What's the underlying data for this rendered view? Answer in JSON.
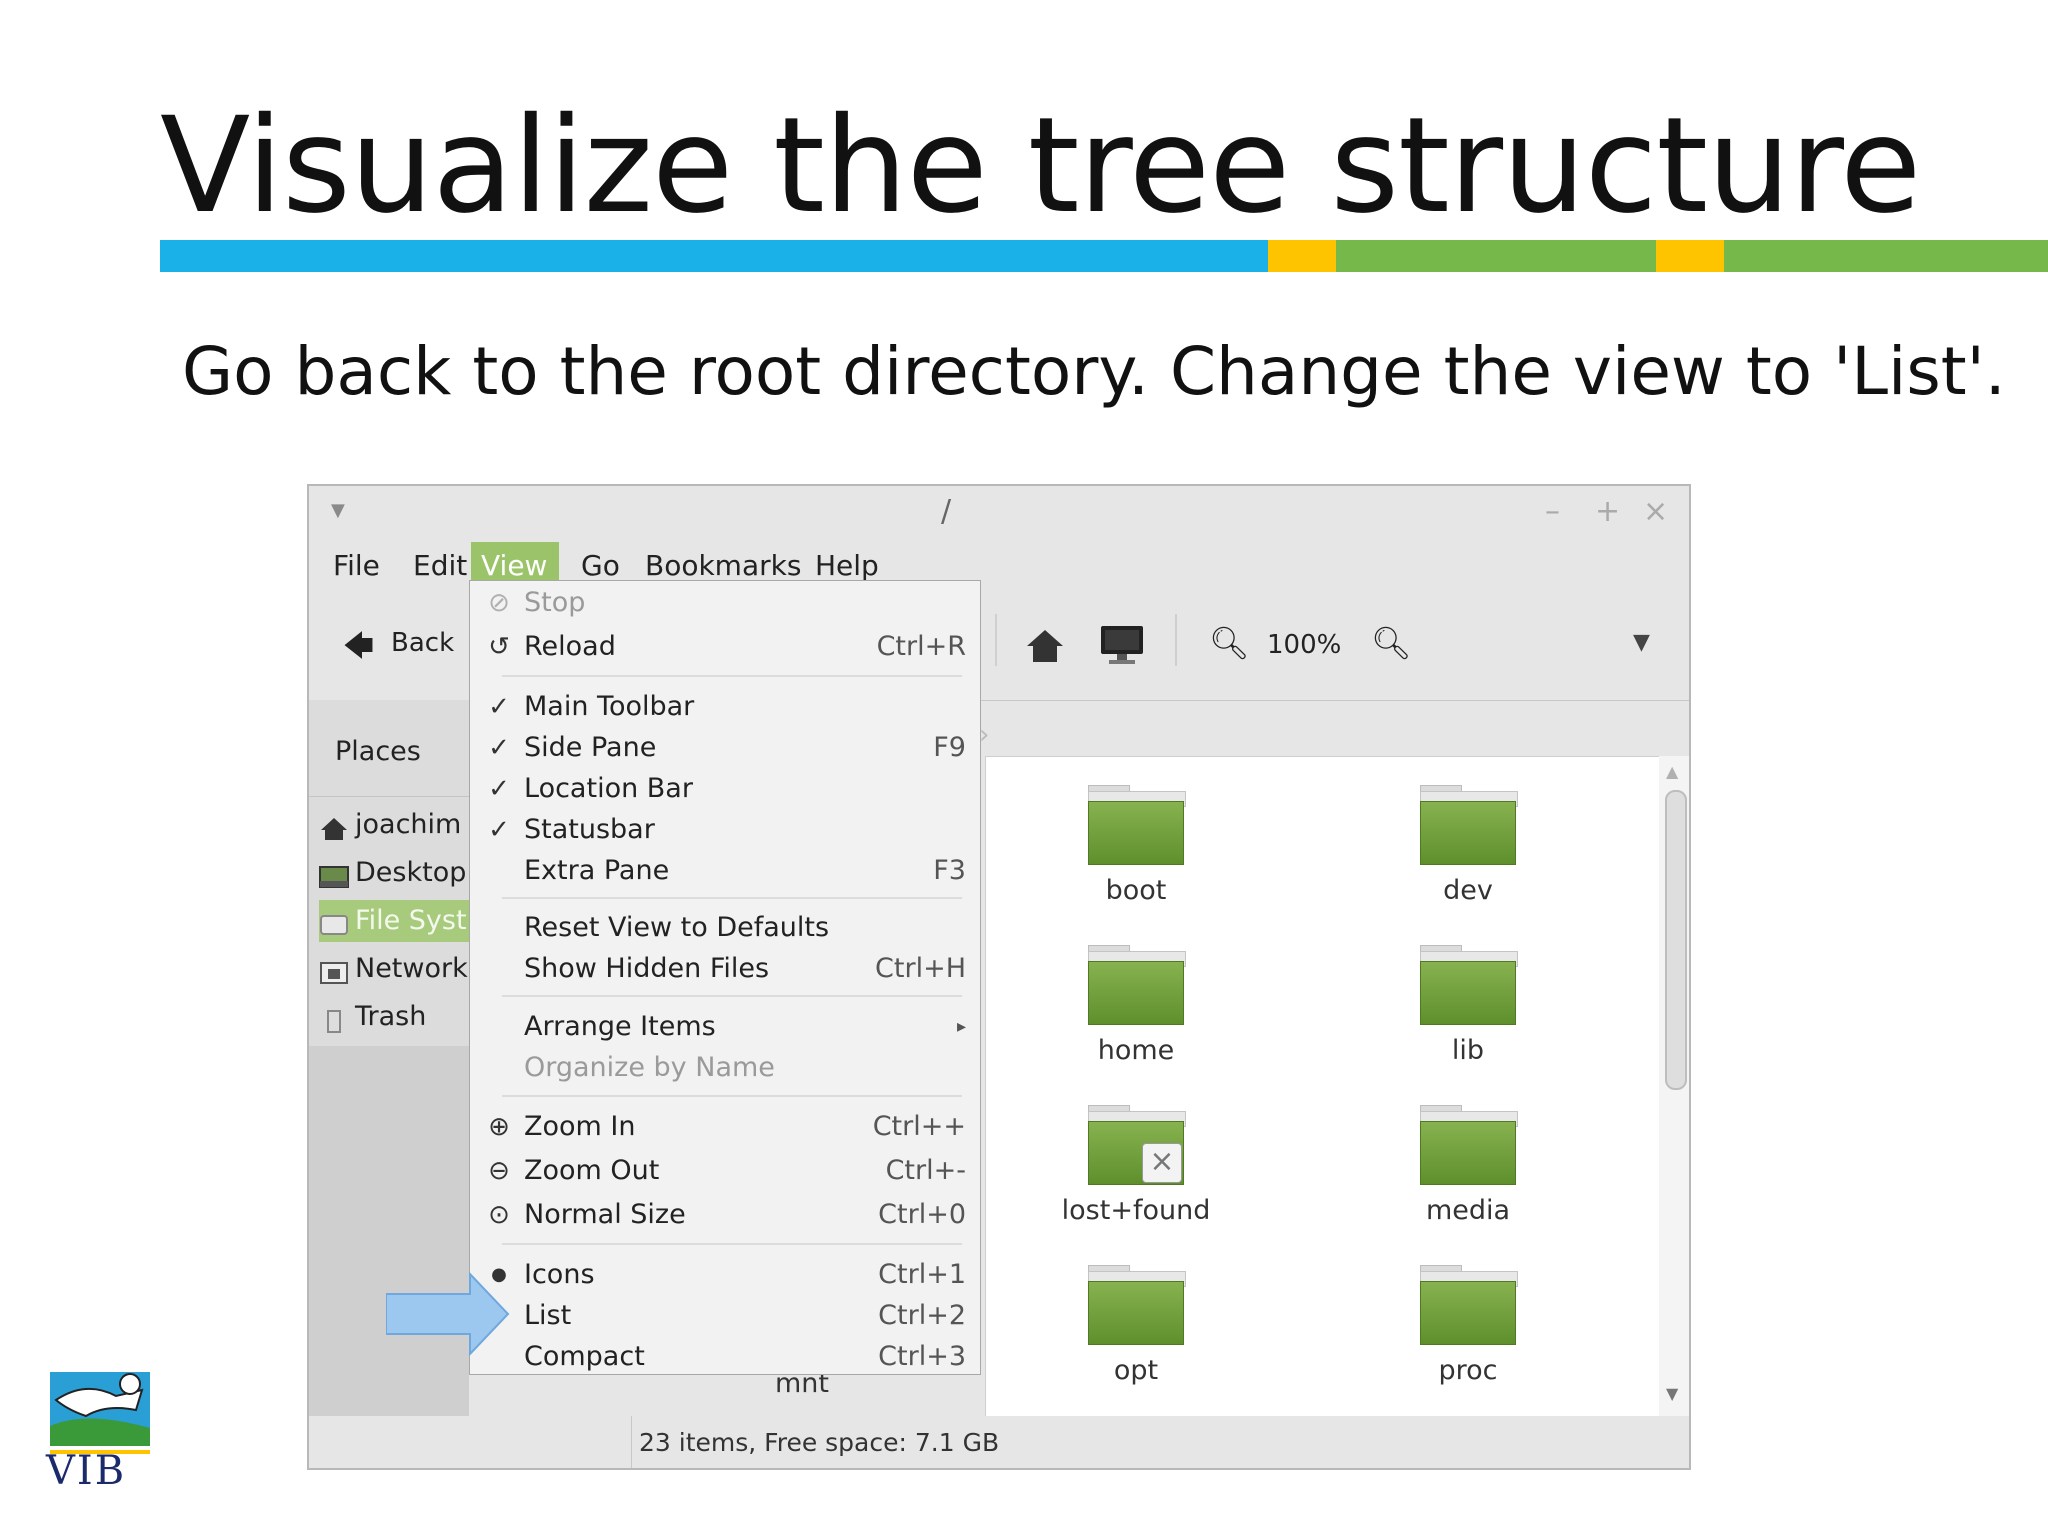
{
  "slide": {
    "title": "Visualize the tree structure",
    "subtitle": "Go back to the root directory. Change the view to 'List'.",
    "accent_colors": {
      "blue": "#1ab0e8",
      "yellow": "#ffc400",
      "green": "#77b84a"
    }
  },
  "window": {
    "title": "/",
    "controls": {
      "minimize": "–",
      "maximize": "+",
      "close": "×"
    },
    "menu": [
      {
        "key": "file",
        "label": "File"
      },
      {
        "key": "edit",
        "label": "Edit"
      },
      {
        "key": "view",
        "label": "View"
      },
      {
        "key": "go",
        "label": "Go"
      },
      {
        "key": "bookmarks",
        "label": "Bookmarks"
      },
      {
        "key": "help",
        "label": "Help"
      }
    ],
    "toolbar": {
      "back_label": "Back",
      "zoom_level": "100%"
    },
    "sidebar": {
      "header": "Places",
      "items": [
        {
          "label": "joachim",
          "icon": "home-icon"
        },
        {
          "label": "Desktop",
          "icon": "desktop-icon"
        },
        {
          "label": "File Syst",
          "icon": "drive-icon"
        },
        {
          "label": "Network",
          "icon": "network-icon"
        },
        {
          "label": "Trash",
          "icon": "trash-icon"
        }
      ]
    },
    "folders": [
      {
        "name": "boot"
      },
      {
        "name": "dev"
      },
      {
        "name": "home"
      },
      {
        "name": "lib"
      },
      {
        "name": "lost+found",
        "locked": true
      },
      {
        "name": "media"
      },
      {
        "name": "opt"
      },
      {
        "name": "proc"
      }
    ],
    "hidden_partial_label": "mnt",
    "status": "23 items, Free space: 7.1 GB"
  },
  "view_menu": {
    "items": [
      {
        "label": "Stop",
        "accel": "",
        "icon": "stop-icon",
        "disabled": true
      },
      {
        "label": "Reload",
        "accel": "Ctrl+R",
        "icon": "reload-icon"
      },
      {
        "label": "Main Toolbar",
        "accel": "",
        "icon": "checkmark-icon"
      },
      {
        "label": "Side Pane",
        "accel": "F9",
        "icon": "checkmark-icon"
      },
      {
        "label": "Location Bar",
        "accel": "",
        "icon": "checkmark-icon"
      },
      {
        "label": "Statusbar",
        "accel": "",
        "icon": "checkmark-icon"
      },
      {
        "label": "Extra Pane",
        "accel": "F3",
        "icon": ""
      },
      {
        "label": "Reset View to Defaults",
        "accel": "",
        "icon": ""
      },
      {
        "label": "Show Hidden Files",
        "accel": "Ctrl+H",
        "icon": ""
      },
      {
        "label": "Arrange Items",
        "accel": "▸",
        "icon": ""
      },
      {
        "label": "Organize by Name",
        "accel": "",
        "icon": "",
        "disabled": true
      },
      {
        "label": "Zoom In",
        "accel": "Ctrl++",
        "icon": "zoom-in-icon"
      },
      {
        "label": "Zoom Out",
        "accel": "Ctrl+-",
        "icon": "zoom-out-icon"
      },
      {
        "label": "Normal Size",
        "accel": "Ctrl+0",
        "icon": "zoom-normal-icon"
      },
      {
        "label": "Icons",
        "accel": "Ctrl+1",
        "icon": "radio-dot-icon"
      },
      {
        "label": "List",
        "accel": "Ctrl+2",
        "icon": ""
      },
      {
        "label": "Compact",
        "accel": "Ctrl+3",
        "icon": ""
      }
    ]
  },
  "logo": {
    "text": "VIB"
  }
}
